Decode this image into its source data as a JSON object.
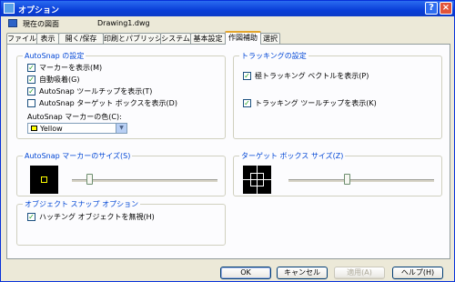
{
  "window": {
    "title": "オプション",
    "help_glyph": "?",
    "close_glyph": "×"
  },
  "drawing": {
    "label": "現在の図面",
    "name": "Drawing1.dwg"
  },
  "tabs": [
    {
      "label": "ファイル"
    },
    {
      "label": "表示"
    },
    {
      "label": "開く/保存"
    },
    {
      "label": "印刷とパブリッシュ"
    },
    {
      "label": "システム"
    },
    {
      "label": "基本設定"
    },
    {
      "label": "作図補助"
    },
    {
      "label": "選択"
    }
  ],
  "autosnap": {
    "title": "AutoSnap の設定",
    "options": [
      {
        "label": "マーカーを表示(M)",
        "checked": true
      },
      {
        "label": "自動吸着(G)",
        "checked": true
      },
      {
        "label": "AutoSnap ツールチップを表示(T)",
        "checked": true
      },
      {
        "label": "AutoSnap ターゲット ボックスを表示(D)",
        "checked": false
      }
    ],
    "color_label": "AutoSnap マーカーの色(C):",
    "color_value": "Yellow",
    "color_hex": "#ffff00"
  },
  "tracking": {
    "title": "トラッキングの設定",
    "options": [
      {
        "label": "極トラッキング ベクトルを表示(P)",
        "checked": true
      },
      {
        "label": "トラッキング ツールチップを表示(K)",
        "checked": true
      }
    ]
  },
  "marker_size": {
    "title": "AutoSnap マーカーのサイズ(S)",
    "level": 0.12
  },
  "aperture_size": {
    "title": "ターゲット ボックス サイズ(Z)",
    "level": 0.4
  },
  "osnap": {
    "title": "オブジェクト スナップ オプション",
    "options": [
      {
        "label": "ハッチング オブジェクトを無視(H)",
        "checked": true
      }
    ]
  },
  "buttons": {
    "ok": "OK",
    "cancel": "キャンセル",
    "apply": "適用(A)",
    "help": "ヘルプ(H)"
  },
  "check_glyph": "✓",
  "arrow_glyph": "▼"
}
